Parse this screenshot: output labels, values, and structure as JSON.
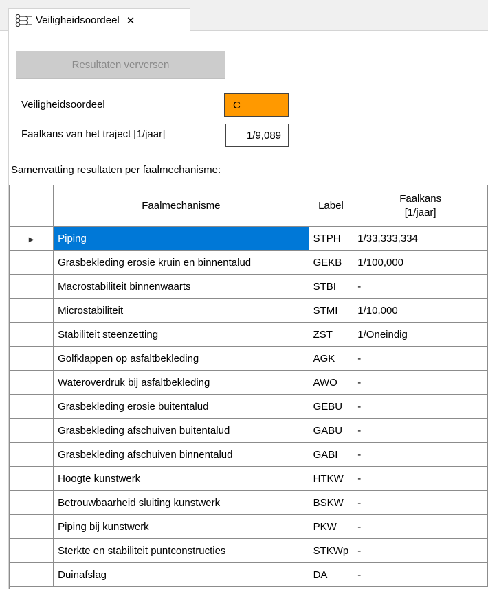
{
  "tab": {
    "icon": "failure-path-icon",
    "title": "Veiligheidsoordeel",
    "close_symbol": "✕"
  },
  "toolbar": {
    "refresh_label": "Resultaten verversen"
  },
  "assessment": {
    "verdict_label": "Veiligheidsoordeel",
    "verdict_value": "C",
    "verdict_color": "#ff9900",
    "probability_label": "Faalkans van het traject [1/jaar]",
    "probability_value": "1/9,089"
  },
  "summary_label": "Samenvatting resultaten per faalmechanisme:",
  "table": {
    "headers": {
      "name": "Faalmechanisme",
      "label": "Label",
      "prob_line1": "Faalkans",
      "prob_line2": "[1/jaar]"
    },
    "selection_color": "#0078d7",
    "rows": [
      {
        "name": "Piping",
        "label": "STPH",
        "prob": "1/33,333,334"
      },
      {
        "name": "Grasbekleding erosie kruin en binnentalud",
        "label": "GEKB",
        "prob": "1/100,000"
      },
      {
        "name": "Macrostabiliteit binnenwaarts",
        "label": "STBI",
        "prob": "-"
      },
      {
        "name": "Microstabiliteit",
        "label": "STMI",
        "prob": "1/10,000"
      },
      {
        "name": "Stabiliteit steenzetting",
        "label": "ZST",
        "prob": "1/Oneindig"
      },
      {
        "name": "Golfklappen op asfaltbekleding",
        "label": "AGK",
        "prob": "-"
      },
      {
        "name": "Wateroverdruk bij asfaltbekleding",
        "label": "AWO",
        "prob": "-"
      },
      {
        "name": "Grasbekleding erosie buitentalud",
        "label": "GEBU",
        "prob": "-"
      },
      {
        "name": "Grasbekleding afschuiven buitentalud",
        "label": "GABU",
        "prob": "-"
      },
      {
        "name": "Grasbekleding afschuiven binnentalud",
        "label": "GABI",
        "prob": "-"
      },
      {
        "name": "Hoogte kunstwerk",
        "label": "HTKW",
        "prob": "-"
      },
      {
        "name": "Betrouwbaarheid sluiting kunstwerk",
        "label": "BSKW",
        "prob": "-"
      },
      {
        "name": "Piping bij kunstwerk",
        "label": "PKW",
        "prob": "-"
      },
      {
        "name": "Sterkte en stabiliteit puntconstructies",
        "label": "STKWp",
        "prob": "-"
      },
      {
        "name": "Duinafslag",
        "label": "DA",
        "prob": "-"
      }
    ]
  }
}
